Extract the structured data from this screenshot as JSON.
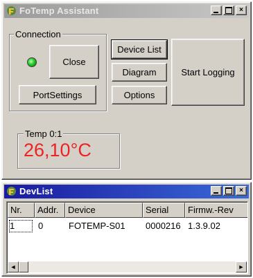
{
  "main_window": {
    "title": "FoTemp Assistant",
    "caption_buttons": {
      "minimize": "_",
      "maximize": "□",
      "close": "×"
    }
  },
  "connection": {
    "group_label": "Connection",
    "status_led_color": "#22cc22",
    "close_label": "Close",
    "port_settings_label": "PortSettings"
  },
  "buttons": {
    "device_list": "Device List",
    "diagram": "Diagram",
    "options": "Options",
    "start_logging": "Start Logging"
  },
  "temperature": {
    "label": "Temp 0:1",
    "value": "26,10°C",
    "value_color": "#ee2222"
  },
  "devlist_window": {
    "title": "DevList",
    "columns": [
      "Nr.",
      "Addr.",
      "Device",
      "Serial",
      "Firmw.-Rev"
    ],
    "rows": [
      {
        "nr": "1",
        "addr": "0",
        "device": "FOTEMP-S01",
        "serial": "0000216",
        "firmware": "1.3.9.02"
      }
    ],
    "scroll_left": "◄",
    "scroll_right": "►"
  }
}
